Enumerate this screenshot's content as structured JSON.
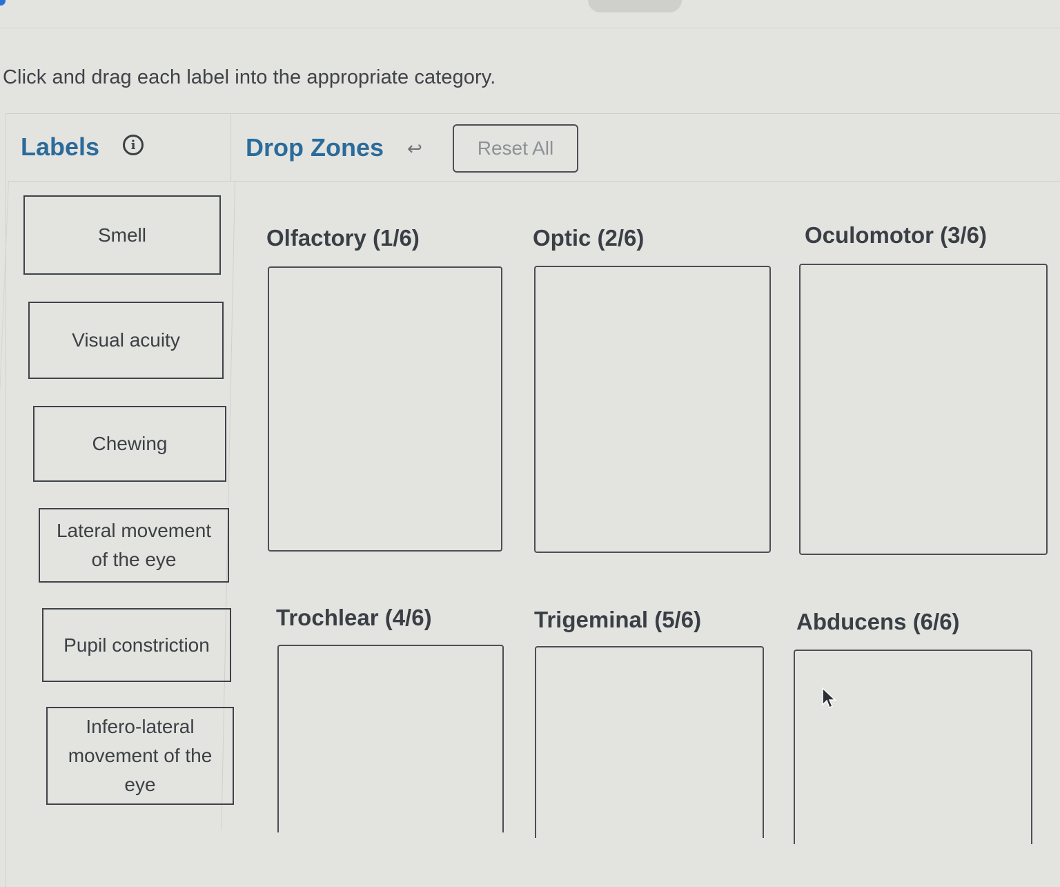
{
  "instructions": "Click and drag each label into the appropriate category.",
  "labels_panel": {
    "title": "Labels",
    "info_glyph": "i",
    "items": [
      {
        "lines": [
          "Smell"
        ]
      },
      {
        "lines": [
          "Visual acuity"
        ]
      },
      {
        "lines": [
          "Chewing"
        ]
      },
      {
        "lines": [
          "Lateral movement",
          "of the eye"
        ]
      },
      {
        "lines": [
          "Pupil constriction"
        ]
      },
      {
        "lines": [
          "Infero-lateral",
          "movement of the",
          "eye"
        ]
      }
    ]
  },
  "drop_zones_panel": {
    "title": "Drop Zones",
    "undo_glyph": "↩",
    "reset_label": "Reset All",
    "zones": [
      {
        "title": "Olfactory (1/6)"
      },
      {
        "title": "Optic (2/6)"
      },
      {
        "title": "Oculomotor (3/6)"
      },
      {
        "title": "Trochlear (4/6)"
      },
      {
        "title": "Trigeminal (5/6)"
      },
      {
        "title": "Abducens (6/6)"
      }
    ]
  },
  "colors": {
    "accent": "#2b6b9a",
    "background": "#e3e3e0",
    "border": "#3e4348"
  },
  "icons": [
    "info-icon",
    "undo-icon",
    "mouse-cursor-icon"
  ]
}
